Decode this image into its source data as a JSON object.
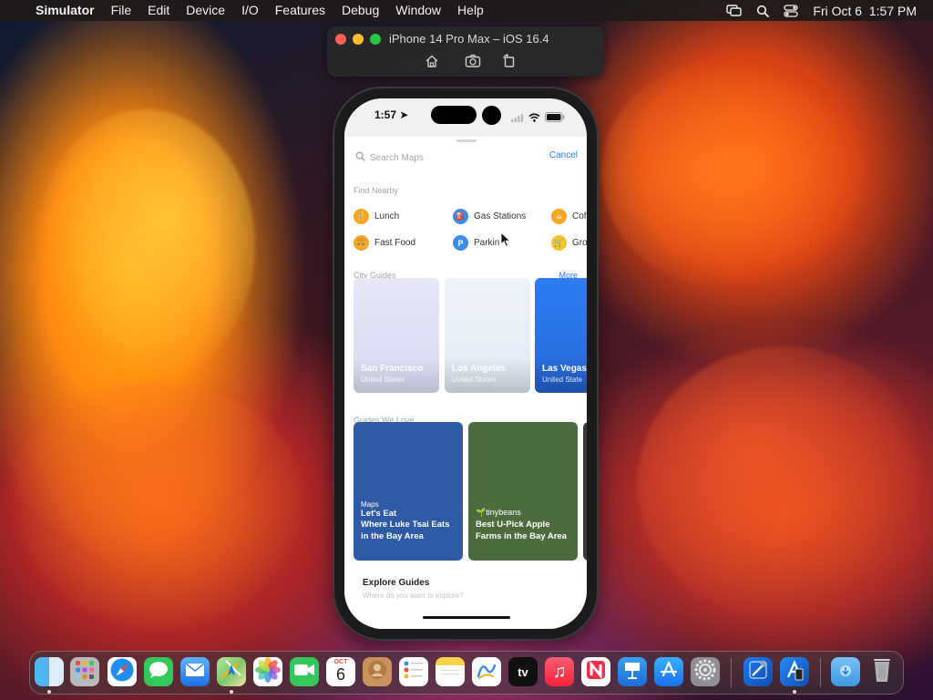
{
  "menubar": {
    "app_name": "Simulator",
    "menus": [
      "File",
      "Edit",
      "Device",
      "I/O",
      "Features",
      "Debug",
      "Window",
      "Help"
    ],
    "status_icons": [
      "screen-mirroring-icon",
      "spotlight-search-icon",
      "control-center-icon"
    ],
    "clock": "Fri Oct 6  1:57 PM"
  },
  "simulator_window": {
    "title": "iPhone 14 Pro Max – iOS 16.4",
    "toolbar_icons": [
      "home-icon",
      "screenshot-icon",
      "rotate-icon"
    ]
  },
  "phone": {
    "status_time": "1:57",
    "search_placeholder": "Search Maps",
    "cancel_label": "Cancel",
    "find_nearby_title": "Find Nearby",
    "nearby": [
      {
        "label": "Lunch",
        "color": "#f5a623",
        "glyph": "🍴"
      },
      {
        "label": "Gas Stations",
        "color": "#3b8de8",
        "glyph": "⛽"
      },
      {
        "label": "Cof",
        "color": "#f5a623",
        "glyph": "☕"
      },
      {
        "label": "Fast Food",
        "color": "#f5a623",
        "glyph": "🍔"
      },
      {
        "label": "Parkin",
        "color": "#3b8de8",
        "glyph": "P"
      },
      {
        "label": "Gro",
        "color": "#f5c623",
        "glyph": "🛒"
      }
    ],
    "city_guides_title": "City Guides",
    "more_label": "More",
    "city_guides": [
      {
        "name": "San Francisco",
        "country": "United States"
      },
      {
        "name": "Los Angeles",
        "country": "United States"
      },
      {
        "name": "Las Vegas",
        "country": "United State"
      }
    ],
    "guides_we_love_title": "Guides We Love",
    "guides": [
      {
        "publisher": "Maps",
        "subtitle": "Let's Eat",
        "title": "Where Luke Tsai Eats in the Bay Area"
      },
      {
        "publisher": "tinybeans",
        "title": "Best U-Pick Apple Farms in the Bay Area"
      }
    ],
    "explore_title": "Explore Guides",
    "explore_subtitle": "Where do you want to explore?"
  },
  "dock": {
    "apps": [
      "Finder",
      "Launchpad",
      "Safari",
      "Messages",
      "Mail",
      "Maps",
      "Photos",
      "FaceTime",
      "Calendar",
      "Contacts",
      "Reminders",
      "Notes",
      "Freeform",
      "TV",
      "Music",
      "News",
      "Keynote",
      "App Store",
      "System Settings",
      "Xcode",
      "Simulator",
      "Downloads",
      "Trash"
    ],
    "calendar_month": "OCT",
    "calendar_day": "6",
    "tv_label": "tv"
  }
}
